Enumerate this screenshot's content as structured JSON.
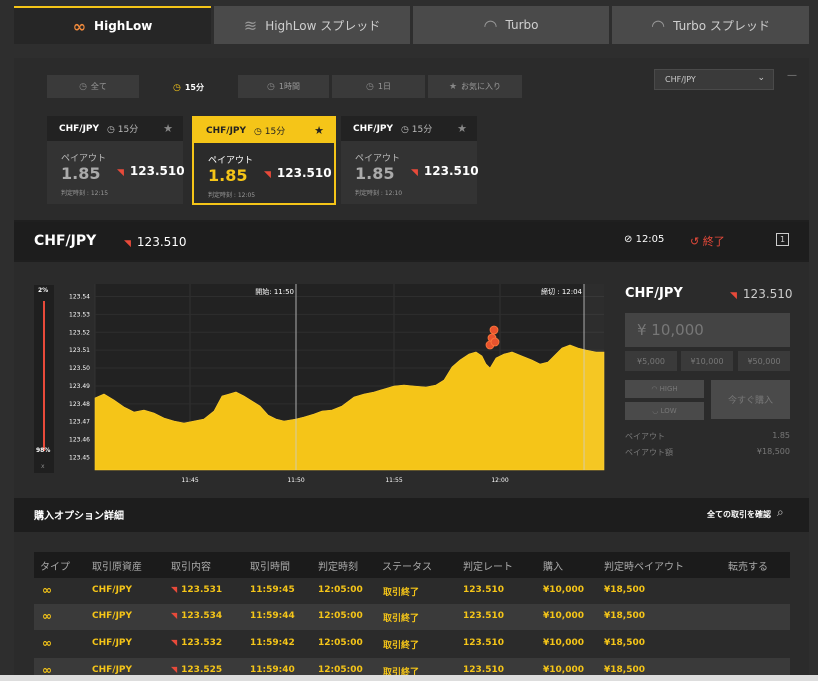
{
  "product_tabs": [
    {
      "label": "HighLow",
      "icon": "highlow-icon",
      "active": true
    },
    {
      "label": "HighLow スプレッド",
      "icon": "spread-icon",
      "active": false
    },
    {
      "label": "Turbo",
      "icon": "speedometer-icon",
      "active": false
    },
    {
      "label": "Turbo スプレッド",
      "icon": "speedometer-spread-icon",
      "active": false
    }
  ],
  "filter_tabs": [
    {
      "label": "全て",
      "icon": "clock-icon",
      "active": false
    },
    {
      "label": "15分",
      "icon": "clock-icon",
      "active": true
    },
    {
      "label": "1時間",
      "icon": "clock-icon",
      "active": false
    },
    {
      "label": "1日",
      "icon": "clock-icon",
      "active": false
    },
    {
      "label": "お気に入り",
      "icon": "star-icon",
      "active": false
    }
  ],
  "asset_select": {
    "value": "CHF/JPY"
  },
  "cards": [
    {
      "pair": "CHF/JPY",
      "time": "15分",
      "payout_label": "ペイアウト",
      "payout": "1.85",
      "rate": "123.510",
      "expiry": "判定時刻 : 12:15",
      "selected": false
    },
    {
      "pair": "CHF/JPY",
      "time": "15分",
      "payout_label": "ペイアウト",
      "payout": "1.85",
      "rate": "123.510",
      "expiry": "判定時刻 : 12:05",
      "selected": true
    },
    {
      "pair": "CHF/JPY",
      "time": "15分",
      "payout_label": "ペイアウト",
      "payout": "1.85",
      "rate": "123.510",
      "expiry": "判定時刻 : 12:10",
      "selected": false
    }
  ],
  "asset_bar": {
    "pair": "CHF/JPY",
    "rate": "123.510",
    "time": "12:05",
    "status": "終了",
    "one": "1"
  },
  "gauge": {
    "top": "2%",
    "bottom": "98%",
    "close": "x"
  },
  "chart_data": {
    "type": "area",
    "y_ticks": [
      "123.54",
      "123.53",
      "123.52",
      "123.51",
      "123.50",
      "123.49",
      "123.48",
      "123.47",
      "123.46",
      "123.45"
    ],
    "x_ticks": [
      "11:45",
      "11:50",
      "11:55",
      "12:00"
    ],
    "start_label": "開始: 11:50",
    "end_label": "締切 : 12:04",
    "ylim": [
      123.443,
      123.547
    ],
    "color": "#f5c518"
  },
  "trade": {
    "pair": "CHF/JPY",
    "rate": "123.510",
    "amount_placeholder": "¥ 10,000",
    "amounts": [
      "¥5,000",
      "¥10,000",
      "¥50,000"
    ],
    "high": "HIGH",
    "low": "LOW",
    "buy": "今すぐ購入",
    "payout_label": "ペイアウト",
    "payout_value": "1.85",
    "payout_amount_label": "ペイアウト額",
    "payout_amount_value": "¥18,500"
  },
  "details": {
    "title": "購入オプション詳細",
    "link": "全ての取引を確認"
  },
  "table": {
    "headers": [
      "タイプ",
      "取引原資産",
      "取引内容",
      "取引時間",
      "判定時刻",
      "ステータス",
      "判定レート",
      "購入",
      "判定時ペイアウト",
      "転売する"
    ],
    "rows": [
      {
        "pair": "CHF/JPY",
        "content": "123.531",
        "time": "11:59:45",
        "expiry": "12:05:00",
        "status": "取引終了",
        "rate": "123.510",
        "buy": "¥10,000",
        "payout": "¥18,500"
      },
      {
        "pair": "CHF/JPY",
        "content": "123.534",
        "time": "11:59:44",
        "expiry": "12:05:00",
        "status": "取引終了",
        "rate": "123.510",
        "buy": "¥10,000",
        "payout": "¥18,500"
      },
      {
        "pair": "CHF/JPY",
        "content": "123.532",
        "time": "11:59:42",
        "expiry": "12:05:00",
        "status": "取引終了",
        "rate": "123.510",
        "buy": "¥10,000",
        "payout": "¥18,500"
      },
      {
        "pair": "CHF/JPY",
        "content": "123.525",
        "time": "11:59:40",
        "expiry": "12:05:00",
        "status": "取引終了",
        "rate": "123.510",
        "buy": "¥10,000",
        "payout": "¥18,500"
      }
    ]
  }
}
